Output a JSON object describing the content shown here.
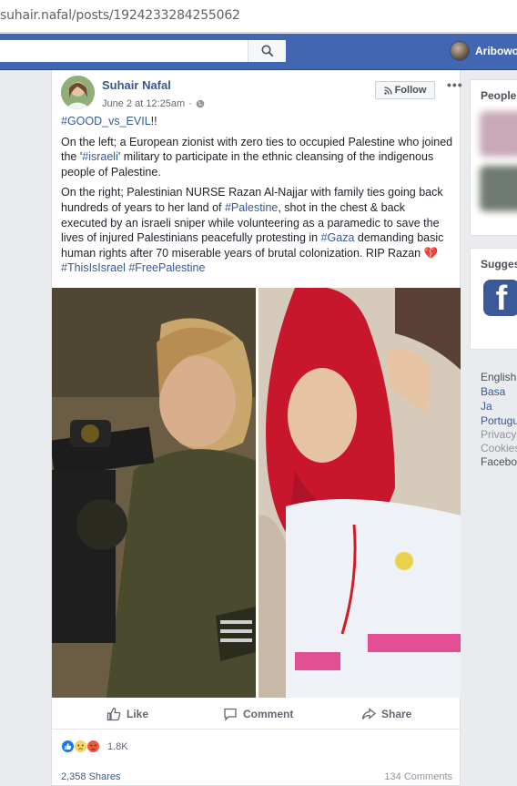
{
  "browser": {
    "url": "suhair.nafal/posts/1924233284255062"
  },
  "topbar": {
    "user_name": "Aribowo"
  },
  "post": {
    "author": "Suhair Nafal",
    "timestamp": "June 2 at 12:25am",
    "follow_label": "Follow",
    "more_label": "•••",
    "text": {
      "hashtag_title": "#GOOD_vs_EVIL",
      "title_suffix": "!!",
      "p1": "On the left; a European zionist with zero ties to occupied Palestine who joined the '",
      "p1_link": "#israeli",
      "p1_end": "' military to participate in the ethnic cleansing of the indigenous people of Palestine.",
      "p2_a": "On the right; Palestinian NURSE Razan Al-Najjar with family ties going back hundreds of years to her land of ",
      "p2_link1": "#Palestine",
      "p2_b": ", shot in the chest & back executed by an israeli sniper while volunteering as a paramedic to save the lives of injured Palestinians peacefully protesting in ",
      "p2_link2": "#Gaza",
      "p2_c": " demanding basic human rights after 70 miserable years of brutal colonization. RIP Razan ",
      "p2_emoji": "💔",
      "p2_link3": "#ThisIsIsrael",
      "p2_link4": "#FreePalestine"
    },
    "actions": {
      "like": "Like",
      "comment": "Comment",
      "share": "Share"
    },
    "reactions_count": "1.8K",
    "shares": "2,358 Shares",
    "comments": "134 Comments"
  },
  "sidebar": {
    "people_title": "People",
    "suggested_title": "Sugges",
    "languages": [
      "English",
      "Basa Ja",
      "Portugu"
    ],
    "footer": [
      "Privacy",
      "Cookies",
      "Facebo"
    ]
  },
  "colors": {
    "fb_blue": "#4267b2",
    "link": "#365899",
    "text": "#1d2129",
    "muted": "#616770"
  }
}
